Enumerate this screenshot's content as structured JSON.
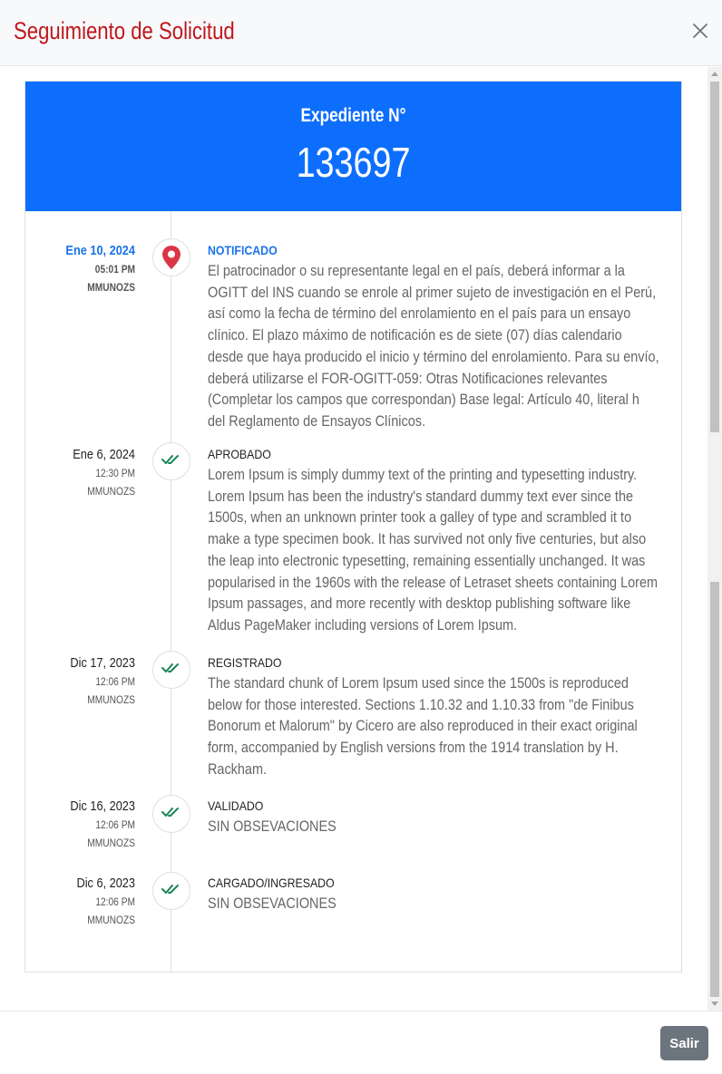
{
  "modal": {
    "title": "Seguimiento de Solicitud",
    "close_icon": "close-icon"
  },
  "banner": {
    "label": "Expediente N°",
    "number": "133697",
    "color": "#0d6efd"
  },
  "timeline": [
    {
      "date": "Ene 10, 2024",
      "time": "05:01 PM",
      "user": "MMUNOZS",
      "icon": "map-pin-icon",
      "status": "NOTIFICADO",
      "active": true,
      "description": "El patrocinador o su representante legal en el país, deberá informar a la OGITT del INS cuando se enrole al primer sujeto de investigación en el Perú, así como la fecha de término del enrolamiento en el país para un ensayo clínico. El plazo máximo de notificación es de siete (07) días calendario desde que haya producido el inicio y término del enrolamiento. Para su envío, deberá utilizarse el FOR-OGITT-059: Otras Notificaciones relevantes (Completar los campos que correspondan) Base legal: Artículo 40, literal h del Reglamento de Ensayos Clínicos."
    },
    {
      "date": "Ene 6, 2024",
      "time": "12:30 PM",
      "user": "MMUNOZS",
      "icon": "double-check-icon",
      "status": "APROBADO",
      "active": false,
      "description": "Lorem Ipsum is simply dummy text of the printing and typesetting industry. Lorem Ipsum has been the industry's standard dummy text ever since the 1500s, when an unknown printer took a galley of type and scrambled it to make a type specimen book. It has survived not only five centuries, but also the leap into electronic typesetting, remaining essentially unchanged. It was popularised in the 1960s with the release of Letraset sheets containing Lorem Ipsum passages, and more recently with desktop publishing software like Aldus PageMaker including versions of Lorem Ipsum."
    },
    {
      "date": "Dic 17, 2023",
      "time": "12:06 PM",
      "user": "MMUNOZS",
      "icon": "double-check-icon",
      "status": "REGISTRADO",
      "active": false,
      "description": "The standard chunk of Lorem Ipsum used since the 1500s is reproduced below for those interested. Sections 1.10.32 and 1.10.33 from \"de Finibus Bonorum et Malorum\" by Cicero are also reproduced in their exact original form, accompanied by English versions from the 1914 translation by H. Rackham."
    },
    {
      "date": "Dic 16, 2023",
      "time": "12:06 PM",
      "user": "MMUNOZS",
      "icon": "double-check-icon",
      "status": "VALIDADO",
      "active": false,
      "description": "SIN OBSEVACIONES"
    },
    {
      "date": "Dic 6, 2023",
      "time": "12:06 PM",
      "user": "MMUNOZS",
      "icon": "double-check-icon",
      "status": "CARGADO/INGRESADO",
      "active": false,
      "description": "SIN OBSEVACIONES"
    }
  ],
  "footer": {
    "exit_label": "Salir"
  },
  "colors": {
    "title": "#c0161d",
    "accent": "#1a73e8",
    "pin": "#dc3545",
    "check": "#198754",
    "exit_button": "#6c757d"
  }
}
